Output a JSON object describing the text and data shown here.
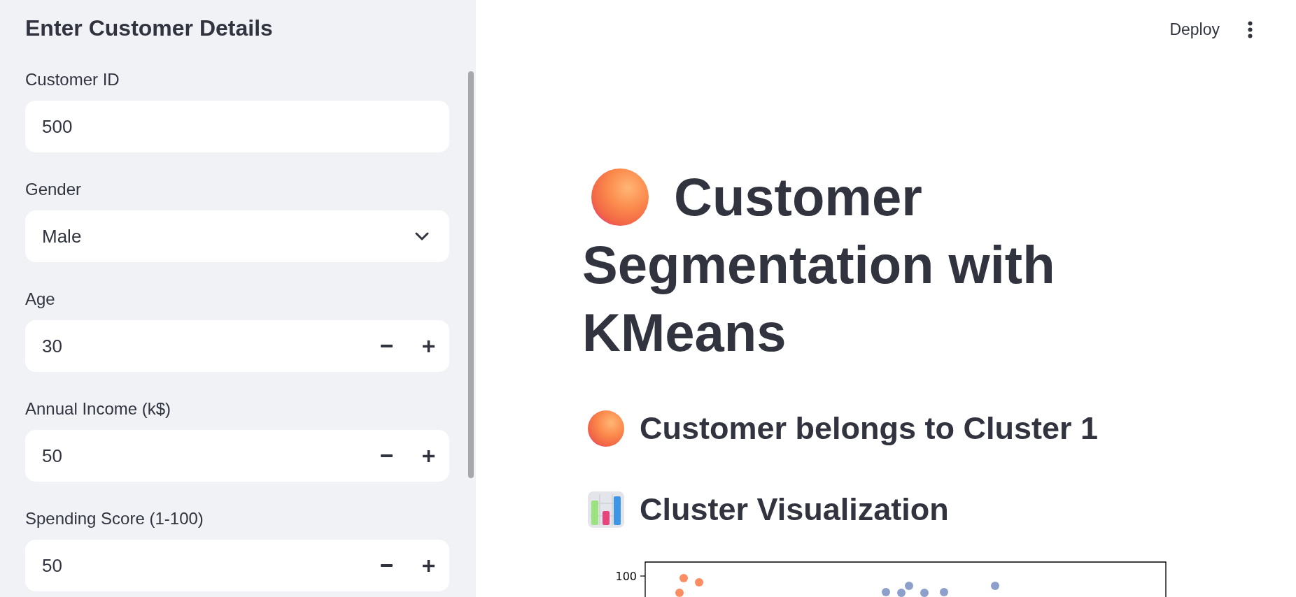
{
  "sidebar": {
    "title": "Enter Customer Details",
    "fields": [
      {
        "kind": "text",
        "label": "Customer ID",
        "value": "500"
      },
      {
        "kind": "select",
        "label": "Gender",
        "value": "Male"
      },
      {
        "kind": "number",
        "label": "Age",
        "value": "30"
      },
      {
        "kind": "number",
        "label": "Annual Income (k$)",
        "value": "50"
      },
      {
        "kind": "number",
        "label": "Spending Score (1-100)",
        "value": "50"
      }
    ]
  },
  "header": {
    "deploy_label": "Deploy"
  },
  "main": {
    "title_parts": [
      "Customer",
      "Segmentation with KMeans"
    ],
    "result": "Customer belongs to Cluster 1",
    "chart_heading": "Cluster Visualization",
    "chart": {
      "y_tick_labels": [
        "100"
      ]
    }
  }
}
